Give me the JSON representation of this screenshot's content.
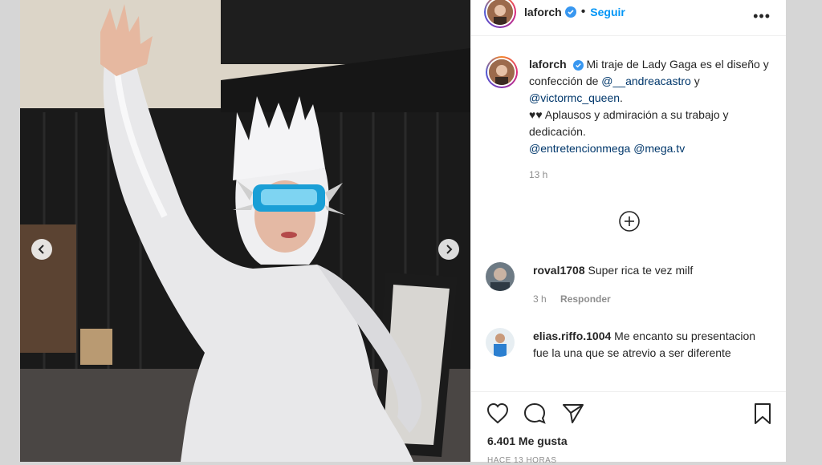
{
  "post": {
    "username": "laforch",
    "follow_label": "Seguir",
    "more_label": "•••",
    "caption": {
      "username": "laforch",
      "text_1": "Mi traje de Lady Gaga es el diseño y confección de",
      "mention_1": "@__andreacastro",
      "conj": "y",
      "mention_2": "@victormc_queen",
      "text_2": ".",
      "text_3": "♥♥ Aplausos y admiración a su trabajo y dedicación.",
      "mention_3": "@entretencionmega",
      "mention_4": "@mega.tv",
      "time": "13 h"
    },
    "comments": [
      {
        "username": "roval1708",
        "text": "Super rica te vez milf",
        "time": "3 h",
        "reply_label": "Responder"
      },
      {
        "username": "elias.riffo.1004",
        "text": "Me encanto su presentacion fue la una que se atrevio a ser diferente"
      }
    ],
    "likes": "6.401 Me gusta",
    "ago": "HACE 13 HORAS"
  },
  "colors": {
    "link": "#00376b",
    "follow": "#0095f6",
    "verified": "#3897f0"
  },
  "icons": {
    "prev": "chevron-left-icon",
    "next": "chevron-right-icon",
    "like": "heart-icon",
    "comment": "comment-icon",
    "share": "paper-plane-icon",
    "save": "bookmark-icon",
    "load_more": "plus-circle-icon"
  }
}
